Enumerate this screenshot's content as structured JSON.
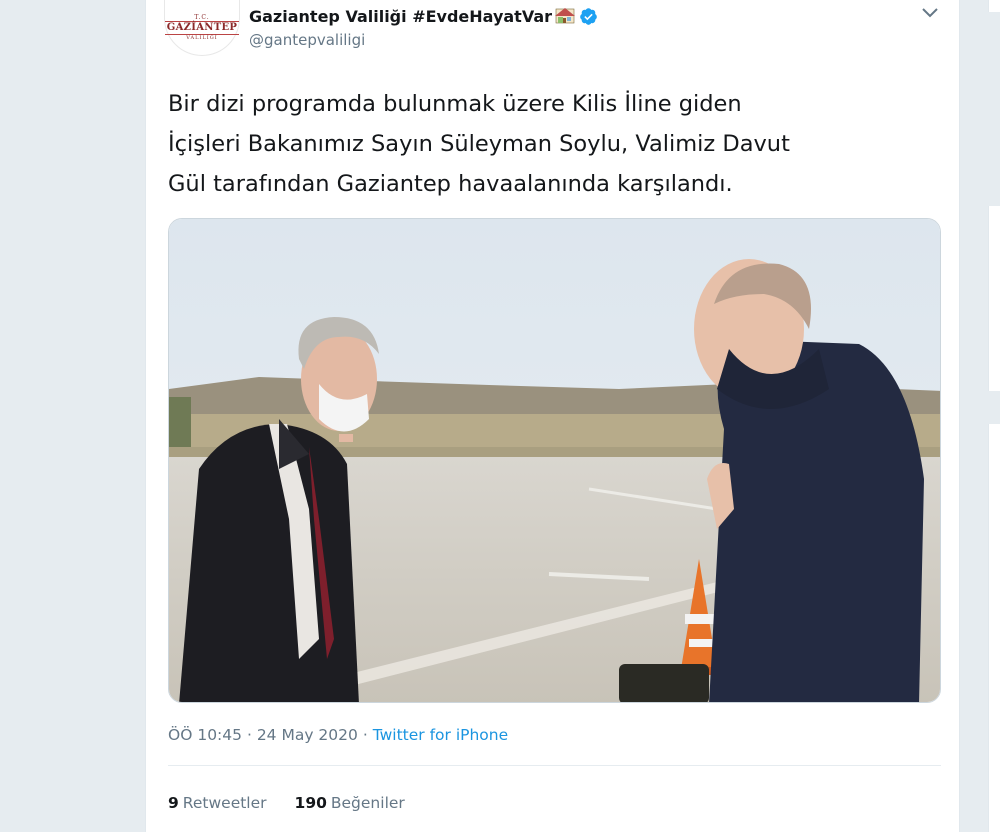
{
  "account": {
    "display_name": "Gaziantep Valiliği #EvdeHayatVar",
    "handle": "@gantepvaliligi",
    "verified": true,
    "avatar_icon": "gaziantep-logo-avatar",
    "avatar_text": {
      "small": "T.C.",
      "main": "GAZİANTEP",
      "sub": "VALİLİĞİ"
    }
  },
  "tweet": {
    "text": "Bir dizi programda bulunmak üzere Kilis İline giden\nİçişleri Bakanımız Sayın Süleyman Soylu, Valimiz Davut\nGül tarafından Gaziantep havaalanında karşılandı.",
    "media": {
      "description_icon": "photo-airport-meeting"
    },
    "time": "ÖÖ 10:45",
    "date": "24 May 2020",
    "separator": "·",
    "source": "Twitter for iPhone"
  },
  "stats": {
    "retweets_count": "9",
    "retweets_label": "Retweetler",
    "likes_count": "190",
    "likes_label": "Beğeniler"
  },
  "colors": {
    "link": "#1b95e0",
    "secondary_text": "#657786",
    "verified_badge": "#1da1f2",
    "page_background": "#e6ecf0"
  }
}
